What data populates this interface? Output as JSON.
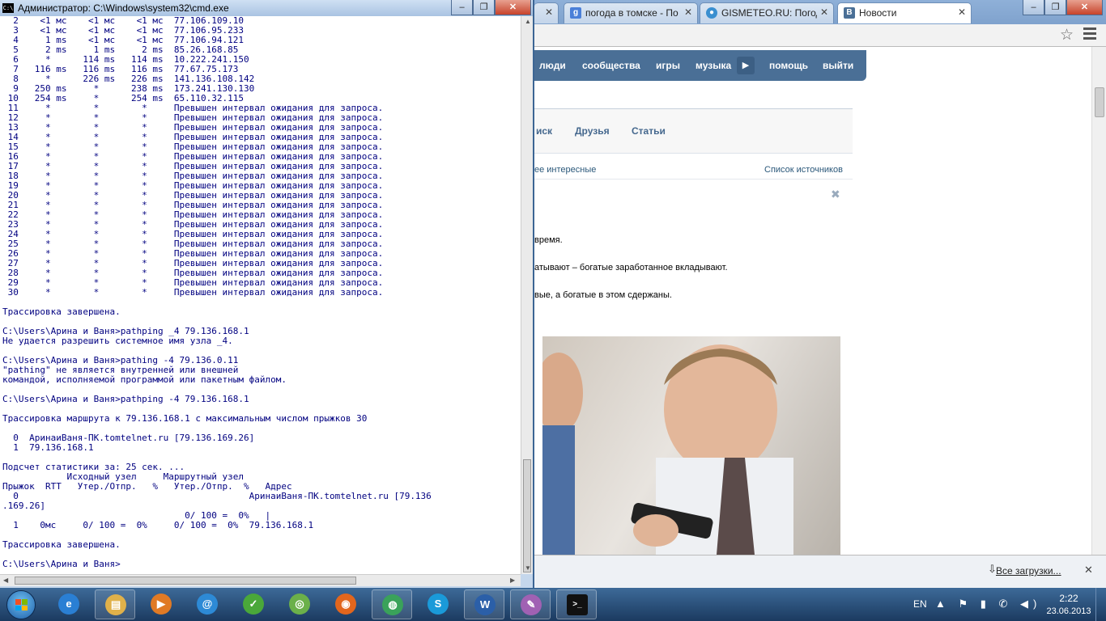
{
  "browser": {
    "tabs": [
      {
        "label": "",
        "icon": "close-icon"
      },
      {
        "label": "погода в томске - По",
        "icon": "google-icon"
      },
      {
        "label": "GISMETEO.RU: Погод",
        "icon": "gismeteo-icon"
      },
      {
        "label": "Новости",
        "icon": "vk-icon"
      }
    ],
    "window_buttons": {
      "minimize": "–",
      "maximize": "❐",
      "close": "✕"
    }
  },
  "vk": {
    "nav": [
      "люди",
      "сообщества",
      "игры",
      "музыка",
      "помощь",
      "выйти"
    ],
    "sub_tabs": [
      "иск",
      "Друзья",
      "Статьи"
    ],
    "feed_filter": "ее интересные",
    "sources_link": "Список источников",
    "post_lines": [
      "время.",
      "атывают – богатые заработанное вкладывают.",
      "вые, а богатые в этом сдержаны."
    ]
  },
  "downloads": {
    "all_label": "Все загрузки..."
  },
  "cmd": {
    "title": "Администратор: C:\\Windows\\system32\\cmd.exe",
    "lines": [
      "  2    <1 мс    <1 мс    <1 мс  77.106.109.10",
      "  3    <1 мс    <1 мс    <1 мс  77.106.95.233",
      "  4     1 ms    <1 мс    <1 мс  77.106.94.121",
      "  5     2 ms     1 ms     2 ms  85.26.168.85",
      "  6     *      114 ms   114 ms  10.222.241.150",
      "  7   116 ms   116 ms   116 ms  77.67.75.173",
      "  8     *      226 ms   226 ms  141.136.108.142",
      "  9   250 ms     *      238 ms  173.241.130.130",
      " 10   254 ms     *      254 ms  65.110.32.115",
      " 11     *        *        *     Превышен интервал ожидания для запроса.",
      " 12     *        *        *     Превышен интервал ожидания для запроса.",
      " 13     *        *        *     Превышен интервал ожидания для запроса.",
      " 14     *        *        *     Превышен интервал ожидания для запроса.",
      " 15     *        *        *     Превышен интервал ожидания для запроса.",
      " 16     *        *        *     Превышен интервал ожидания для запроса.",
      " 17     *        *        *     Превышен интервал ожидания для запроса.",
      " 18     *        *        *     Превышен интервал ожидания для запроса.",
      " 19     *        *        *     Превышен интервал ожидания для запроса.",
      " 20     *        *        *     Превышен интервал ожидания для запроса.",
      " 21     *        *        *     Превышен интервал ожидания для запроса.",
      " 22     *        *        *     Превышен интервал ожидания для запроса.",
      " 23     *        *        *     Превышен интервал ожидания для запроса.",
      " 24     *        *        *     Превышен интервал ожидания для запроса.",
      " 25     *        *        *     Превышен интервал ожидания для запроса.",
      " 26     *        *        *     Превышен интервал ожидания для запроса.",
      " 27     *        *        *     Превышен интервал ожидания для запроса.",
      " 28     *        *        *     Превышен интервал ожидания для запроса.",
      " 29     *        *        *     Превышен интервал ожидания для запроса.",
      " 30     *        *        *     Превышен интервал ожидания для запроса.",
      "",
      "Трассировка завершена.",
      "",
      "C:\\Users\\Арина и Ваня>pathping _4 79.136.168.1",
      "Не удается разрешить системное имя узла _4.",
      "",
      "C:\\Users\\Арина и Ваня>pathing -4 79.136.0.11",
      "\"pathing\" не является внутренней или внешней",
      "командой, исполняемой программой или пакетным файлом.",
      "",
      "C:\\Users\\Арина и Ваня>pathping -4 79.136.168.1",
      "",
      "Трассировка маршрута к 79.136.168.1 с максимальным числом прыжков 30",
      "",
      "  0  АринаиВаня-ПК.tomtelnet.ru [79.136.169.26]",
      "  1  79.136.168.1",
      "",
      "Подсчет статистики за: 25 сек. ...",
      "            Исходный узел     Маршрутный узел",
      "Прыжок  RTT   Утер./Отпр.   %   Утер./Отпр.  %   Адрес",
      "  0                                           АринаиВаня-ПК.tomtelnet.ru [79.136",
      ".169.26]",
      "                                  0/ 100 =  0%   |",
      "  1    0мс     0/ 100 =  0%     0/ 100 =  0%  79.136.168.1",
      "",
      "Трассировка завершена.",
      "",
      "C:\\Users\\Арина и Ваня>"
    ]
  },
  "taskbar": {
    "apps": [
      {
        "name": "ie-icon",
        "glyph": "e",
        "color": "#2a7fd4",
        "open": false
      },
      {
        "name": "explorer-icon",
        "glyph": "▤",
        "color": "#e0b14a",
        "open": true
      },
      {
        "name": "media-player-icon",
        "glyph": "▶",
        "color": "#e07a25",
        "open": false
      },
      {
        "name": "skype-alt-icon",
        "glyph": "@",
        "color": "#2d8ad6",
        "open": false
      },
      {
        "name": "downloader-icon",
        "glyph": "✓",
        "color": "#4aa83a",
        "open": false
      },
      {
        "name": "wifi-icon",
        "glyph": "◎",
        "color": "#6bb04a",
        "open": false
      },
      {
        "name": "firefox-icon",
        "glyph": "◉",
        "color": "#e2661d",
        "open": false
      },
      {
        "name": "chrome-icon",
        "glyph": "◍",
        "color": "#3aa25a",
        "open": true
      },
      {
        "name": "skype-icon",
        "glyph": "S",
        "color": "#1a9ad9",
        "open": false
      },
      {
        "name": "word-icon",
        "glyph": "W",
        "color": "#2b5fa8",
        "open": true
      },
      {
        "name": "notes-icon",
        "glyph": "✎",
        "color": "#a061b3",
        "open": true
      },
      {
        "name": "cmd-icon",
        "glyph": ">_",
        "color": "#111111",
        "open": true
      }
    ],
    "lang": "EN",
    "tray_glyphs": "▲ ⚑ ▮ ✆ ◀)",
    "time": "2:22",
    "date": "23.06.2013"
  }
}
